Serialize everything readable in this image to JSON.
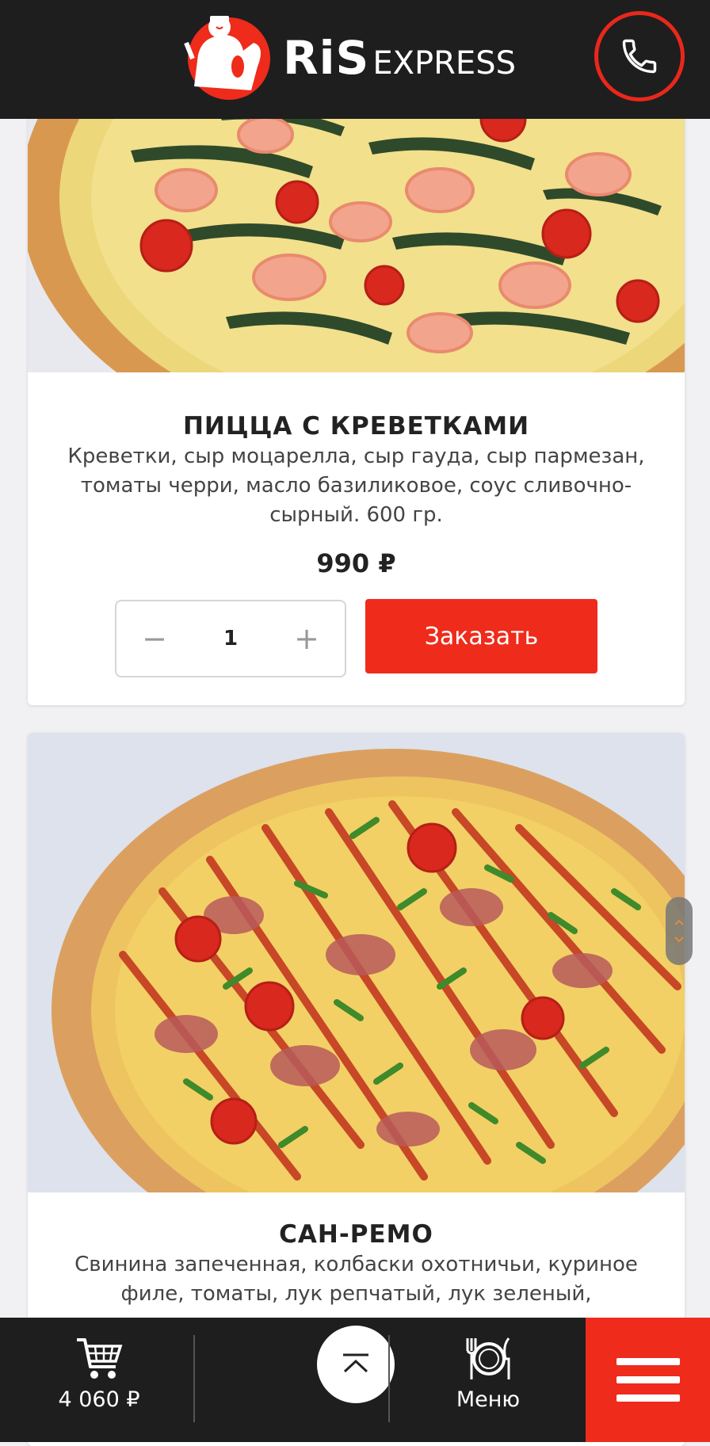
{
  "header": {
    "logo_main": "RiS",
    "logo_sub": "EXPRESS",
    "phone_icon": "phone-icon"
  },
  "products": [
    {
      "title": "ПИЦЦА С КРЕВЕТКАМИ",
      "description": "Креветки, сыр моцарелла, сыр гауда, сыр пармезан, томаты черри, масло базиликовое, соус сливочно-сырный. 600 гр.",
      "price": "990 ₽",
      "quantity": "1",
      "order_label": "Заказать"
    },
    {
      "title": "САН-РЕМО",
      "description": "Свинина запеченная, колбаски охотничьи, куриное филе, томаты, лук репчатый, лук зеленый,"
    }
  ],
  "bottom_bar": {
    "cart_total": "4 060 ₽",
    "menu_label": "Меню"
  },
  "colors": {
    "accent": "#ef2b1b",
    "header_bg": "#1e1e1e"
  }
}
